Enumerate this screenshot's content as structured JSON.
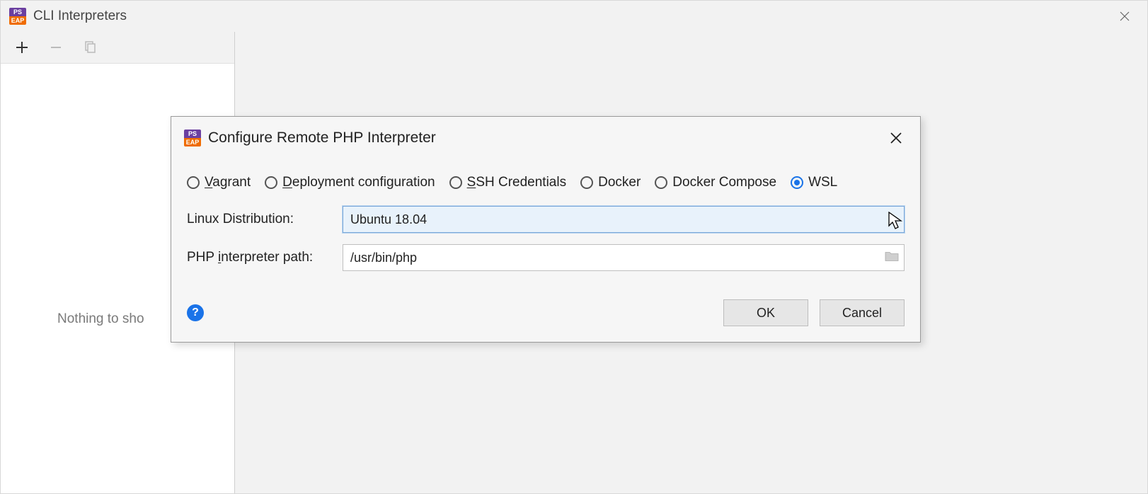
{
  "parent": {
    "title": "CLI Interpreters",
    "nothing_label": "Nothing to sho"
  },
  "toolbar": {
    "add_label": "Add",
    "remove_label": "Remove",
    "copy_label": "Copy"
  },
  "modal": {
    "title": "Configure Remote PHP Interpreter",
    "radios": {
      "vagrant_mn": "V",
      "vagrant_rest": "agrant",
      "deploy_mn": "D",
      "deploy_rest": "eployment configuration",
      "ssh_mn": "S",
      "ssh_rest": "SH Credentials",
      "docker": "Docker",
      "docker_compose": "Docker Compose",
      "wsl": "WSL"
    },
    "linux_label": "Linux Distribution:",
    "linux_value": "Ubuntu 18.04",
    "php_label_pre": "PHP ",
    "php_label_mn": "i",
    "php_label_post": "nterpreter path:",
    "php_value": "/usr/bin/php",
    "ok_label": "OK",
    "cancel_label": "Cancel",
    "help_glyph": "?"
  }
}
